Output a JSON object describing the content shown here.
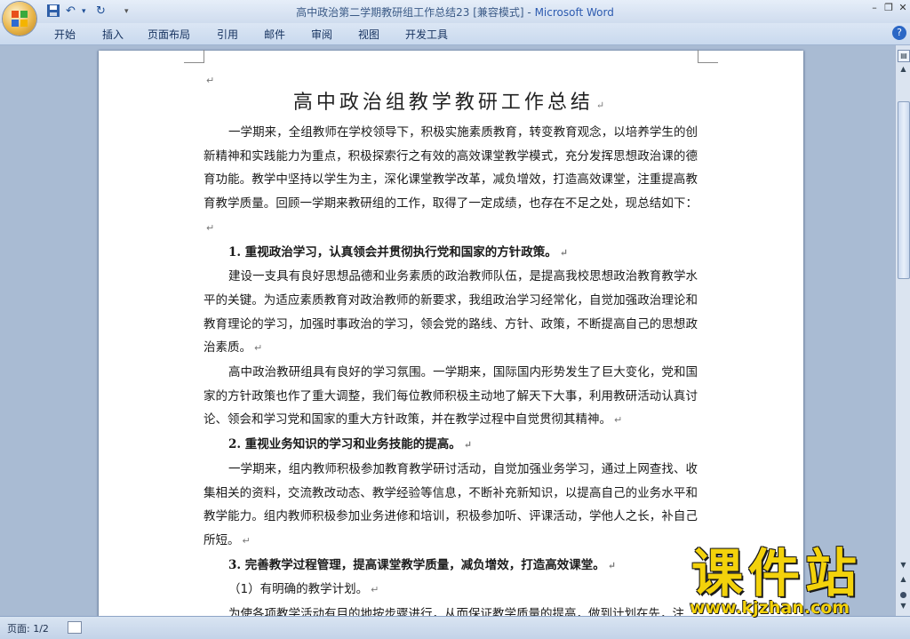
{
  "window": {
    "title": "高中政治第二学期教研组工作总结23 [兼容模式] - ",
    "app": "Microsoft Word"
  },
  "ribbon": {
    "tabs": [
      "开始",
      "插入",
      "页面布局",
      "引用",
      "邮件",
      "审阅",
      "视图",
      "开发工具"
    ]
  },
  "document": {
    "heading": "高中政治组教学教研工作总结",
    "paragraphs": [
      {
        "kind": "body",
        "text": "一学期来，全组教师在学校领导下，积极实施素质教育，转变教育观念，以培养学生的创新精神和实践能力为重点，积极探索行之有效的高效课堂教学模式，充分发挥思想政治课的德育功能。教学中坚持以学生为主，深化课堂教学改革，减负增效，打造高效课堂，注重提高教育教学质量。回顾一学期来教研组的工作，取得了一定成绩，也存在不足之处，现总结如下："
      },
      {
        "kind": "head",
        "text": "1. 重视政治学习，认真领会并贯彻执行党和国家的方针政策。"
      },
      {
        "kind": "body",
        "text": "建设一支具有良好思想品德和业务素质的政治教师队伍，是提高我校思想政治教育教学水平的关键。为适应素质教育对政治教师的新要求，我组政治学习经常化，自觉加强政治理论和教育理论的学习，加强时事政治的学习，领会党的路线、方针、政策，不断提高自己的思想政治素质。"
      },
      {
        "kind": "body",
        "text": "高中政治教研组具有良好的学习氛围。一学期来，国际国内形势发生了巨大变化，党和国家的方针政策也作了重大调整，我们每位教师积极主动地了解天下大事，利用教研活动认真讨论、领会和学习党和国家的重大方针政策，并在教学过程中自觉贯彻其精神。"
      },
      {
        "kind": "head",
        "text": "2. 重视业务知识的学习和业务技能的提高。"
      },
      {
        "kind": "body",
        "text": "一学期来，组内教师积极参加教育教学研讨活动，自觉加强业务学习，通过上网查找、收集相关的资料，交流教改动态、教学经验等信息，不断补充新知识，以提高自己的业务水平和教学能力。组内教师积极参加业务进修和培训，积极参加听、评课活动，学他人之长，补自己所短。"
      },
      {
        "kind": "head",
        "text": "3. 完善教学过程管理，提高课堂教学质量，减负增效，打造高效课堂。"
      },
      {
        "kind": "sub",
        "text": "（1）有明确的教学计划。"
      },
      {
        "kind": "body",
        "text": "为使各项教学活动有目的地按步骤进行，从而保证教学质量的提高，做到计划在先，注"
      }
    ]
  },
  "statusbar": {
    "page": "页面: 1/2"
  },
  "watermark": {
    "title": "课件站",
    "url": "www.kjzhan.com"
  }
}
